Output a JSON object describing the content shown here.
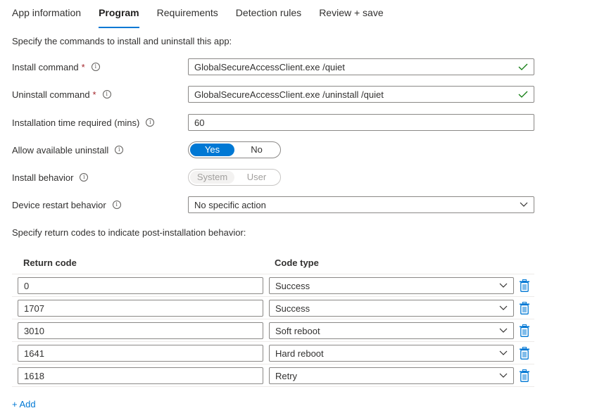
{
  "tabs": [
    {
      "label": "App information",
      "active": false
    },
    {
      "label": "Program",
      "active": true
    },
    {
      "label": "Requirements",
      "active": false
    },
    {
      "label": "Detection rules",
      "active": false
    },
    {
      "label": "Review + save",
      "active": false
    }
  ],
  "intro_text": "Specify the commands to install and uninstall this app:",
  "install_command": {
    "label": "Install command",
    "required": "*",
    "value": "GlobalSecureAccessClient.exe /quiet"
  },
  "uninstall_command": {
    "label": "Uninstall command",
    "required": "*",
    "value": "GlobalSecureAccessClient.exe /uninstall /quiet"
  },
  "install_time": {
    "label": "Installation time required (mins)",
    "value": "60"
  },
  "allow_uninstall": {
    "label": "Allow available uninstall",
    "options": [
      "Yes",
      "No"
    ],
    "selected": "Yes"
  },
  "install_behavior": {
    "label": "Install behavior",
    "options": [
      "System",
      "User"
    ],
    "selected": "System",
    "disabled": true
  },
  "restart_behavior": {
    "label": "Device restart behavior",
    "value": "No specific action"
  },
  "return_codes_text": "Specify return codes to indicate post-installation behavior:",
  "return_codes": {
    "headers": {
      "code": "Return code",
      "type": "Code type"
    },
    "rows": [
      {
        "code": "0",
        "type": "Success"
      },
      {
        "code": "1707",
        "type": "Success"
      },
      {
        "code": "3010",
        "type": "Soft reboot"
      },
      {
        "code": "1641",
        "type": "Hard reboot"
      },
      {
        "code": "1618",
        "type": "Retry"
      }
    ]
  },
  "add_link": "+ Add",
  "colors": {
    "accent": "#0078d4",
    "success": "#107c10",
    "required": "#a4262c"
  }
}
